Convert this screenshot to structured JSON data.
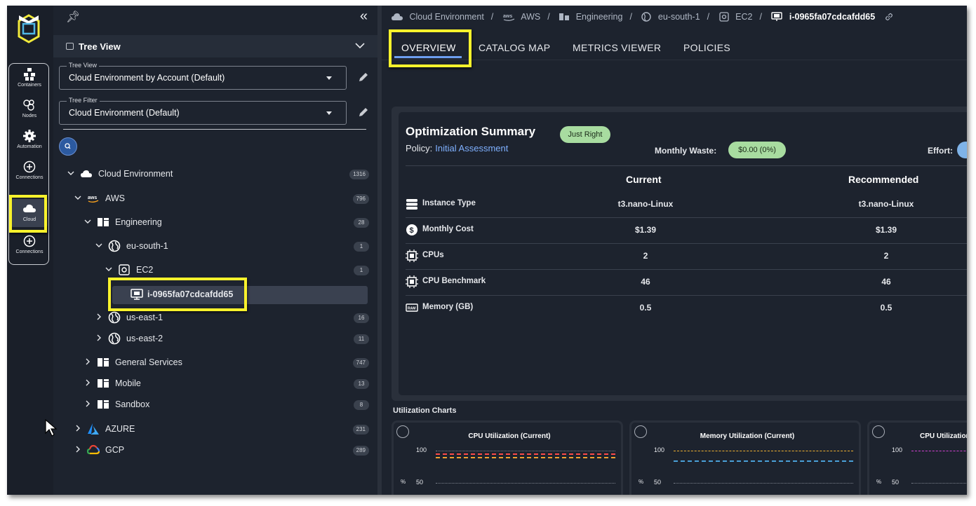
{
  "rail": {
    "items": [
      {
        "label": "Containers",
        "icon": "containers-icon"
      },
      {
        "label": "Nodes",
        "icon": "nodes-icon"
      },
      {
        "label": "Automation",
        "icon": "gear-icon"
      },
      {
        "label": "Connections",
        "icon": "plus-circle-icon"
      },
      {
        "label": "Cloud",
        "icon": "cloud-icon",
        "active": true
      },
      {
        "label": "Connections",
        "icon": "plus-circle-icon"
      }
    ]
  },
  "panel": {
    "title": "Tree View",
    "tree_view": {
      "label": "Tree View",
      "value": "Cloud Environment by Account (Default)"
    },
    "tree_filter": {
      "label": "Tree Filter",
      "value": "Cloud Environment (Default)"
    },
    "tree": [
      {
        "label": "Cloud Environment",
        "count": "1316"
      },
      {
        "label": "AWS",
        "count": "796"
      },
      {
        "label": "Engineering",
        "count": "28"
      },
      {
        "label": "eu-south-1",
        "count": "1"
      },
      {
        "label": "EC2",
        "count": "1"
      },
      {
        "label": "i-0965fa07cdcafdd65",
        "count": ""
      },
      {
        "label": "us-east-1",
        "count": "16"
      },
      {
        "label": "us-east-2",
        "count": "11"
      },
      {
        "label": "General Services",
        "count": "747"
      },
      {
        "label": "Mobile",
        "count": "13"
      },
      {
        "label": "Sandbox",
        "count": "8"
      },
      {
        "label": "AZURE",
        "count": "231"
      },
      {
        "label": "GCP",
        "count": "289"
      }
    ]
  },
  "breadcrumb": [
    "Cloud Environment",
    "AWS",
    "Engineering",
    "eu-south-1",
    "EC2",
    "i-0965fa07cdcafdd65"
  ],
  "tabs": [
    "OVERVIEW",
    "CATALOG MAP",
    "METRICS VIEWER",
    "POLICIES"
  ],
  "summary": {
    "title": "Optimization Summary",
    "status": "Just Right",
    "policy_label": "Policy:",
    "policy_value": "Initial Assessment",
    "waste_label": "Monthly Waste:",
    "waste_value": "$0.00 (0%)",
    "effort_label": "Effort:",
    "col_current": "Current",
    "col_recommended": "Recommended",
    "rows": [
      {
        "label": "Instance Type",
        "current": "t3.nano-Linux",
        "recommended": "t3.nano-Linux",
        "icon": "layers-icon"
      },
      {
        "label": "Monthly Cost",
        "current": "$1.39",
        "recommended": "$1.39",
        "icon": "dollar-icon"
      },
      {
        "label": "CPUs",
        "current": "2",
        "recommended": "2",
        "icon": "chip-icon"
      },
      {
        "label": "CPU Benchmark",
        "current": "46",
        "recommended": "46",
        "icon": "chip-icon"
      },
      {
        "label": "Memory (GB)",
        "current": "0.5",
        "recommended": "0.5",
        "icon": "ram-icon"
      }
    ]
  },
  "charts": {
    "section_title": "Utilization Charts",
    "cards": [
      {
        "title": "CPU Utilization (Current)",
        "tick_top": "100",
        "tick_mid": "50",
        "unit": "%"
      },
      {
        "title": "Memory Utilization (Current)",
        "tick_top": "100",
        "tick_mid": "50",
        "unit": "%"
      },
      {
        "title": "CPU Utilization",
        "tick_top": "100",
        "tick_mid": "50",
        "unit": "%"
      }
    ]
  },
  "colors": {
    "accent": "#6d9ef0",
    "highlight": "#f8f22c",
    "just_right": "#a8dca0",
    "link": "#7fb0ff"
  }
}
